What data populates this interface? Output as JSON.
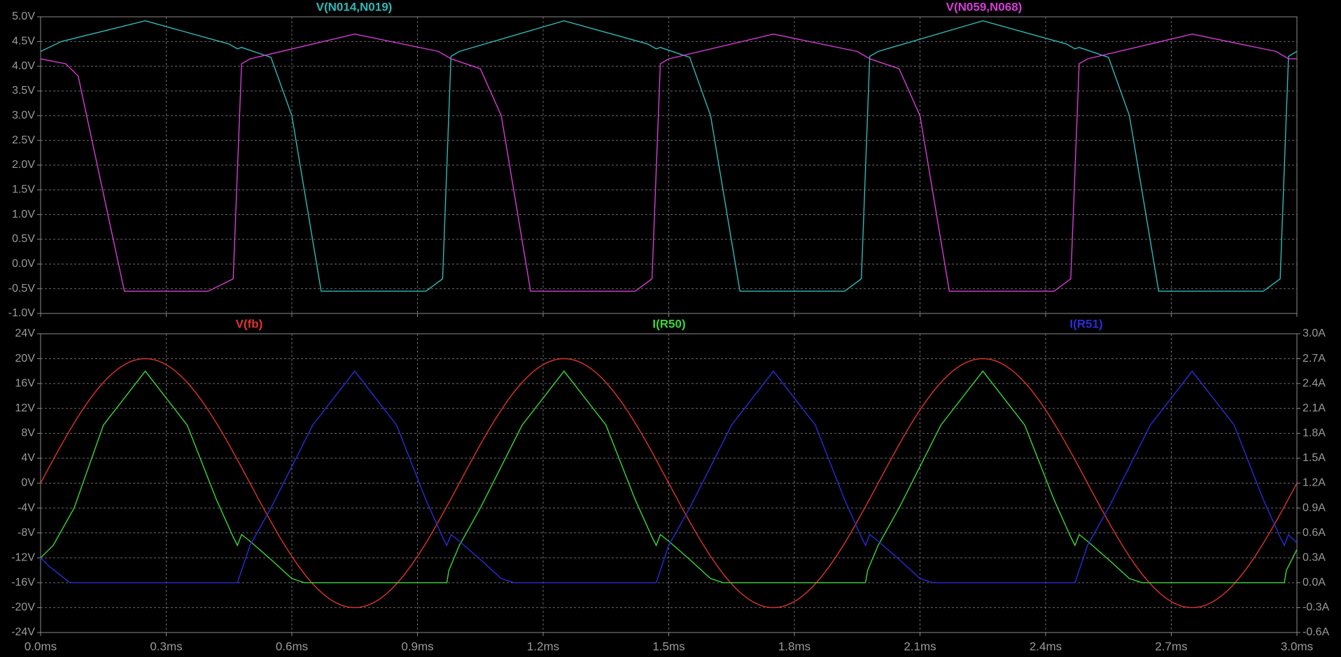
{
  "chart_data": [
    {
      "type": "line",
      "x_axis": {
        "ticks": [
          "0.0ms",
          "0.3ms",
          "0.6ms",
          "0.9ms",
          "1.2ms",
          "1.5ms",
          "1.8ms",
          "2.1ms",
          "2.4ms",
          "2.7ms",
          "3.0ms"
        ],
        "range_ms": [
          0,
          3
        ]
      },
      "y_axis": {
        "ticks": [
          "-1.0V",
          "-0.5V",
          "0.0V",
          "0.5V",
          "1.0V",
          "1.5V",
          "2.0V",
          "2.5V",
          "3.0V",
          "3.5V",
          "4.0V",
          "4.5V",
          "5.0V"
        ],
        "range": [
          -1,
          5
        ]
      },
      "grid": true,
      "series": [
        {
          "name": "V(N014,N019)",
          "color": "#2fb8b8",
          "x_ms": [
            0,
            0.05,
            0.25,
            0.45,
            0.47,
            0.48,
            0.55,
            0.6,
            0.67,
            0.92,
            0.96,
            0.98,
            1.0,
            1.25,
            1.45,
            1.47,
            1.48,
            1.55,
            1.6,
            1.67,
            1.92,
            1.96,
            1.98,
            2.0,
            2.25,
            2.45,
            2.47,
            2.48,
            2.55,
            2.6,
            2.67,
            2.92,
            2.96,
            2.98,
            3.0
          ],
          "y": [
            4.3,
            4.5,
            4.92,
            4.45,
            4.35,
            4.38,
            4.18,
            3.0,
            -0.55,
            -0.55,
            -0.3,
            4.2,
            4.3,
            4.92,
            4.45,
            4.35,
            4.38,
            4.18,
            3.0,
            -0.55,
            -0.55,
            -0.3,
            4.2,
            4.3,
            4.92,
            4.45,
            4.35,
            4.38,
            4.18,
            3.0,
            -0.55,
            -0.55,
            -0.3,
            4.2,
            4.3
          ]
        },
        {
          "name": "V(N059,N068)",
          "color": "#d63cd6",
          "x_ms": [
            0,
            0.06,
            0.09,
            0.11,
            0.2,
            0.4,
            0.46,
            0.48,
            0.5,
            0.75,
            0.95,
            0.97,
            0.98,
            1.05,
            1.1,
            1.17,
            1.42,
            1.46,
            1.48,
            1.5,
            1.75,
            1.95,
            1.97,
            1.98,
            2.05,
            2.1,
            2.17,
            2.42,
            2.46,
            2.48,
            2.5,
            2.75,
            2.95,
            2.97,
            2.98,
            3.0
          ],
          "y": [
            4.15,
            4.05,
            3.8,
            3.0,
            -0.55,
            -0.55,
            -0.3,
            4.05,
            4.15,
            4.65,
            4.3,
            4.2,
            4.15,
            3.95,
            3.0,
            -0.55,
            -0.55,
            -0.3,
            4.05,
            4.15,
            4.65,
            4.3,
            4.2,
            4.15,
            3.95,
            3.0,
            -0.55,
            -0.55,
            -0.3,
            4.05,
            4.15,
            4.65,
            4.3,
            4.2,
            4.15,
            4.15
          ]
        }
      ]
    },
    {
      "type": "line",
      "x_axis": {
        "ticks": [
          "0.0ms",
          "0.3ms",
          "0.6ms",
          "0.9ms",
          "1.2ms",
          "1.5ms",
          "1.8ms",
          "2.1ms",
          "2.4ms",
          "2.7ms",
          "3.0ms"
        ],
        "range_ms": [
          0,
          3
        ]
      },
      "y_axis_left": {
        "ticks": [
          "-24V",
          "-20V",
          "-16V",
          "-12V",
          "-8V",
          "-4V",
          "0V",
          "4V",
          "8V",
          "12V",
          "16V",
          "20V",
          "24V"
        ],
        "range": [
          -24,
          24
        ]
      },
      "y_axis_right": {
        "ticks": [
          "-0.6A",
          "-0.3A",
          "0.0A",
          "0.3A",
          "0.6A",
          "0.9A",
          "1.2A",
          "1.5A",
          "1.8A",
          "2.1A",
          "2.4A",
          "2.7A",
          "3.0A"
        ],
        "range": [
          -0.6,
          3.0
        ]
      },
      "grid": true,
      "series": [
        {
          "name": "V(fb)",
          "color": "#e0342f",
          "axis": "left",
          "kind": "sine",
          "amplitude": 20,
          "period_ms": 1.0,
          "phase_ms": 0
        },
        {
          "name": "I(R50)",
          "color": "#3bd63b",
          "axis": "right",
          "x_ms": [
            0,
            0.03,
            0.08,
            0.15,
            0.25,
            0.35,
            0.42,
            0.46,
            0.47,
            0.48,
            0.5,
            0.55,
            0.6,
            0.63,
            0.97,
            0.975,
            1.0,
            1.05,
            1.15,
            1.25,
            1.35,
            1.42,
            1.46,
            1.47,
            1.48,
            1.5,
            1.55,
            1.6,
            1.63,
            1.97,
            1.975,
            2.0,
            2.05,
            2.15,
            2.25,
            2.35,
            2.42,
            2.46,
            2.47,
            2.48,
            2.5,
            2.55,
            2.6,
            2.63,
            2.97,
            2.975,
            3.0
          ],
          "y": [
            0.3,
            0.45,
            0.9,
            1.9,
            2.55,
            1.9,
            1.0,
            0.55,
            0.45,
            0.58,
            0.5,
            0.28,
            0.05,
            0.0,
            0.0,
            0.15,
            0.45,
            0.9,
            1.9,
            2.55,
            1.9,
            1.0,
            0.55,
            0.45,
            0.58,
            0.5,
            0.28,
            0.05,
            0.0,
            0.0,
            0.15,
            0.45,
            0.9,
            1.9,
            2.55,
            1.9,
            1.0,
            0.55,
            0.45,
            0.58,
            0.5,
            0.28,
            0.05,
            0.0,
            0.0,
            0.15,
            0.4
          ]
        },
        {
          "name": "I(R51)",
          "color": "#2b2bd9",
          "axis": "right",
          "x_ms": [
            0,
            0.02,
            0.05,
            0.07,
            0.47,
            0.48,
            0.5,
            0.55,
            0.65,
            0.75,
            0.85,
            0.92,
            0.96,
            0.97,
            0.98,
            1.0,
            1.05,
            1.1,
            1.13,
            1.47,
            1.48,
            1.5,
            1.55,
            1.65,
            1.75,
            1.85,
            1.92,
            1.96,
            1.97,
            1.98,
            2.0,
            2.05,
            2.1,
            2.13,
            2.47,
            2.48,
            2.5,
            2.55,
            2.65,
            2.75,
            2.85,
            2.92,
            2.96,
            2.97,
            2.98,
            3.0
          ],
          "y": [
            0.3,
            0.2,
            0.08,
            0.0,
            0.0,
            0.15,
            0.45,
            0.9,
            1.9,
            2.55,
            1.9,
            1.0,
            0.55,
            0.45,
            0.58,
            0.5,
            0.28,
            0.05,
            0.0,
            0.0,
            0.15,
            0.45,
            0.9,
            1.9,
            2.55,
            1.9,
            1.0,
            0.55,
            0.45,
            0.58,
            0.5,
            0.28,
            0.05,
            0.0,
            0.0,
            0.15,
            0.45,
            0.9,
            1.9,
            2.55,
            1.9,
            1.0,
            0.55,
            0.45,
            0.58,
            0.48
          ]
        }
      ]
    }
  ],
  "style": {
    "background": "#000000",
    "frame": "#8a8a8a",
    "grid": "#6a6a6a",
    "tick_text": "#9a9a9a"
  }
}
